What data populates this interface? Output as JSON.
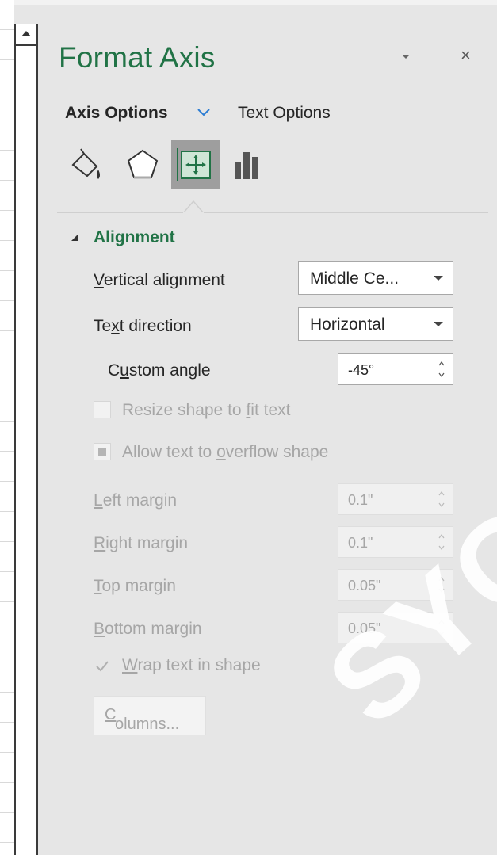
{
  "panel": {
    "title": "Format Axis",
    "tabs": [
      {
        "label": "Axis Options",
        "active": true
      },
      {
        "label": "Text Options",
        "active": false
      }
    ],
    "icons": [
      "fill-line-icon",
      "effects-icon",
      "size-properties-icon",
      "axis-options-icon"
    ],
    "accent_color": "#217346"
  },
  "alignment": {
    "section_title": "Alignment",
    "vertical_alignment": {
      "prefix": "V",
      "rest": "ertical alignment",
      "value": "Middle Ce..."
    },
    "text_direction": {
      "prefix": "Te",
      "underline": "x",
      "rest": "t direction",
      "value": "Horizontal"
    },
    "custom_angle": {
      "prefix": "C",
      "underline": "u",
      "rest": "stom angle",
      "value": "-45°"
    },
    "resize_shape": {
      "prefix": "Resize shape to ",
      "underline": "f",
      "rest": "it text",
      "checked": false
    },
    "allow_overflow": {
      "prefix": "Allow text to ",
      "underline": "o",
      "rest": "verflow shape",
      "checked": true
    },
    "left_margin": {
      "underline": "L",
      "rest": "eft margin",
      "value": "0.1\""
    },
    "right_margin": {
      "underline": "R",
      "rest": "ight margin",
      "value": "0.1\""
    },
    "top_margin": {
      "underline": "T",
      "rest": "op margin",
      "value": "0.05\""
    },
    "bottom_margin": {
      "underline": "B",
      "rest": "ottom margin",
      "value": "0.05\""
    },
    "wrap_text": {
      "underline": "W",
      "rest": "rap text in shape",
      "checked": true
    },
    "columns_button": {
      "underline": "C",
      "rest": "olumns..."
    }
  },
  "watermark": "SYCH"
}
